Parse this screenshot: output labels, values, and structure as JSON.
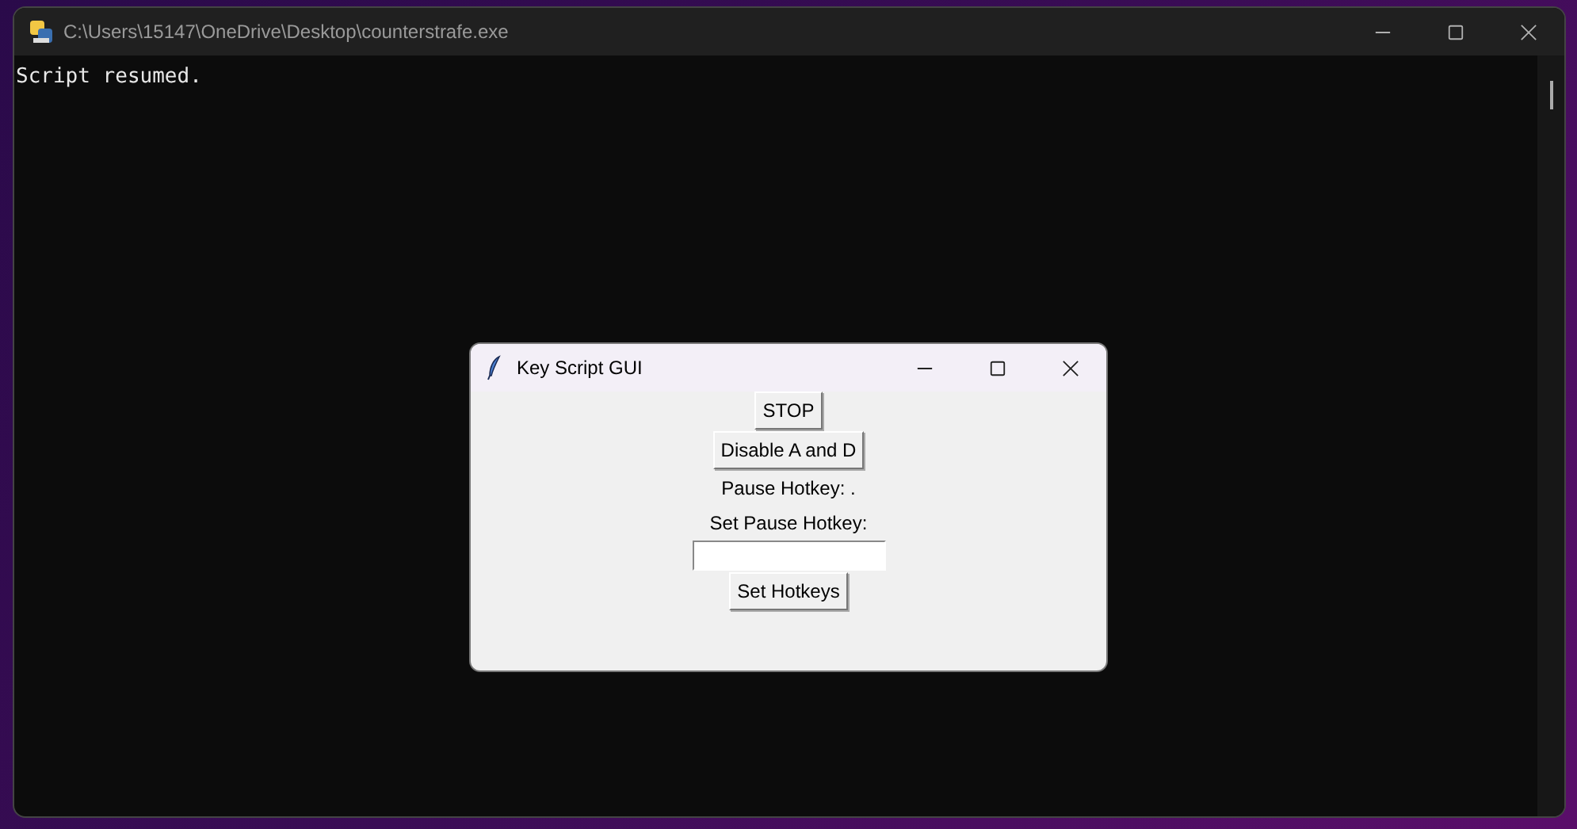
{
  "console_window": {
    "title": "C:\\Users\\15147\\OneDrive\\Desktop\\counterstrafe.exe",
    "output": [
      "Script resumed."
    ]
  },
  "dialog": {
    "title": "Key Script GUI",
    "controls": [
      {
        "kind": "button",
        "label": "STOP"
      },
      {
        "kind": "button",
        "label": "Disable A and D"
      },
      {
        "kind": "label",
        "text": "Pause Hotkey: ."
      },
      {
        "kind": "label",
        "text": "Set Pause Hotkey:"
      },
      {
        "kind": "field"
      },
      {
        "kind": "button",
        "label": "Set Hotkeys"
      }
    ]
  }
}
